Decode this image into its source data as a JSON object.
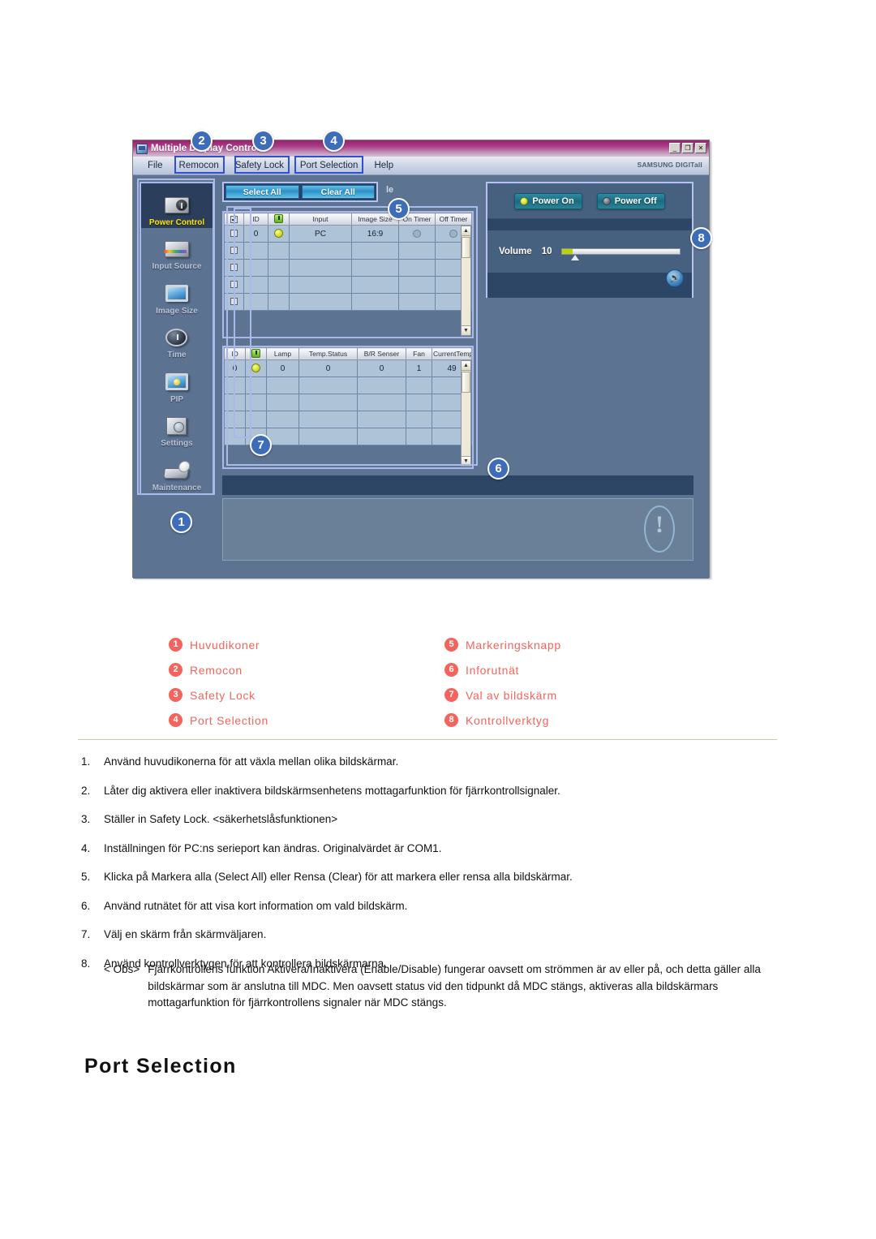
{
  "app": {
    "title": "Multiple Display Control",
    "titlebar_icon": "app-icon",
    "window_buttons": [
      {
        "name": "minimize-button",
        "glyph": "_"
      },
      {
        "name": "maximize-button",
        "glyph": "❐"
      },
      {
        "name": "close-button",
        "glyph": "✕"
      }
    ],
    "menu": [
      "File",
      "Remocon",
      "Safety Lock",
      "Port Selection",
      "Help"
    ],
    "brand": "SAMSUNG DIGITall"
  },
  "sidebar": {
    "items": [
      {
        "label": "Power Control",
        "icon": "power-control-icon",
        "active": true
      },
      {
        "label": "Input Source",
        "icon": "input-source-icon",
        "active": false
      },
      {
        "label": "Image Size",
        "icon": "image-size-icon",
        "active": false
      },
      {
        "label": "Time",
        "icon": "time-icon",
        "active": false
      },
      {
        "label": "PIP",
        "icon": "pip-icon",
        "active": false
      },
      {
        "label": "Settings",
        "icon": "settings-icon",
        "active": false
      },
      {
        "label": "Maintenance",
        "icon": "maintenance-icon",
        "active": false
      }
    ]
  },
  "toolbar": {
    "select_all": "Select All",
    "clear_all": "Clear All",
    "enable_label": "le"
  },
  "grid_main": {
    "headers": [
      "",
      "ID",
      "",
      "Input",
      "Image Size",
      "On Timer",
      "Off Timer"
    ],
    "rows": [
      {
        "checked": false,
        "id": "0",
        "power": "on",
        "input": "PC",
        "image_size": "16:9",
        "on_timer": "circle",
        "off_timer": "circle"
      }
    ],
    "empty_rows": 4
  },
  "grid_info": {
    "headers": [
      "ID",
      "",
      "Lamp",
      "Temp.Status",
      "B/R Senser",
      "Fan",
      "CurrentTemp."
    ],
    "rows": [
      {
        "id": "0",
        "power": "on",
        "lamp": "0",
        "temp_status": "0",
        "br_senser": "0",
        "fan": "1",
        "current_temp": "49"
      }
    ],
    "empty_rows": 4
  },
  "control_panel": {
    "power_on": "Power On",
    "power_off": "Power Off",
    "volume_label": "Volume",
    "volume_value": "10",
    "speaker_icon": "speaker-icon"
  },
  "badges": [
    "1",
    "2",
    "3",
    "4",
    "5",
    "6",
    "7",
    "8"
  ],
  "legend": {
    "left": [
      {
        "num": "1",
        "text": "Huvudikoner"
      },
      {
        "num": "2",
        "text": "Remocon"
      },
      {
        "num": "3",
        "text": "Safety Lock"
      },
      {
        "num": "4",
        "text": "Port Selection"
      }
    ],
    "right": [
      {
        "num": "5",
        "text": "Markeringsknapp"
      },
      {
        "num": "6",
        "text": "Inforutnät"
      },
      {
        "num": "7",
        "text": "Val av bildskärm"
      },
      {
        "num": "8",
        "text": "Kontrollverktyg"
      }
    ]
  },
  "steps": [
    {
      "n": "1.",
      "text": "Använd huvudikonerna för att växla mellan olika bildskärmar."
    },
    {
      "n": "2.",
      "text": "Låter dig aktivera eller inaktivera bildskärmsenhetens mottagarfunktion för fjärrkontrollsignaler."
    },
    {
      "n": "3.",
      "text": "Ställer in Safety Lock. <säkerhetslåsfunktionen>"
    },
    {
      "n": "4.",
      "text": "Inställningen för PC:ns serieport kan ändras. Originalvärdet är COM1."
    },
    {
      "n": "5.",
      "text": "Klicka på Markera alla (Select All) eller Rensa (Clear) för att markera eller rensa alla bildskärmar."
    },
    {
      "n": "6.",
      "text": "Använd rutnätet för att visa kort information om vald bildskärm."
    },
    {
      "n": "7.",
      "text": "Välj en skärm från skärmväljaren."
    },
    {
      "n": "8.",
      "text": "Använd kontrollverktygen för att kontrollera bildskärmarna."
    }
  ],
  "note": {
    "label": "< Obs>",
    "text": "Fjärrkontrollens funktion Aktivera/Inaktivera (Enable/Disable) fungerar oavsett om strömmen är av eller på, och detta gäller alla bildskärmar som är anslutna till MDC. Men oavsett status vid den tidpunkt då MDC stängs, aktiveras alla bildskärmars mottagarfunktion för fjärrkontrollens signaler när MDC stängs."
  },
  "port_heading": "Port Selection",
  "colors": {
    "legend_red": "#f4645c",
    "badge_blue": "#3d6cb9",
    "callout_blue": "#2f4fd6",
    "active_label_yellow": "#ffe400",
    "titlebar_magenta": "#9c1f6e"
  }
}
